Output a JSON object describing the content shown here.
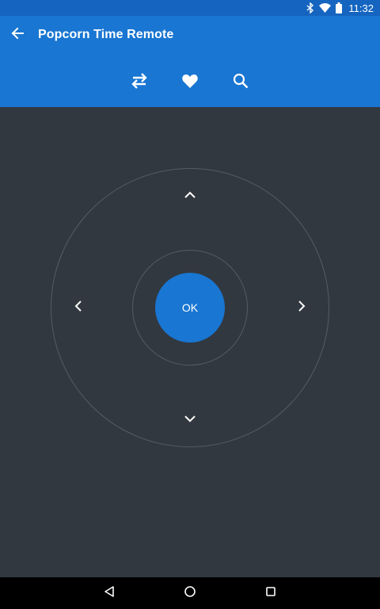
{
  "status_bar": {
    "time": "11:32",
    "icons": [
      "bluetooth-icon",
      "wifi-icon",
      "battery-icon"
    ]
  },
  "app_bar": {
    "title": "Popcorn Time Remote",
    "back_icon": "arrow-back-icon",
    "actions": [
      "swap-icon",
      "heart-icon",
      "search-icon"
    ]
  },
  "remote": {
    "ok_label": "OK",
    "accent": "#1976d2",
    "ring_color": "#555c66"
  },
  "navigation_bar": {
    "buttons": [
      "back-triangle-icon",
      "home-circle-icon",
      "recents-square-icon"
    ]
  },
  "colors": {
    "status_bar": "#1565c0",
    "app_bar": "#1976d2",
    "background": "#323840",
    "nav_bar": "#000000"
  }
}
